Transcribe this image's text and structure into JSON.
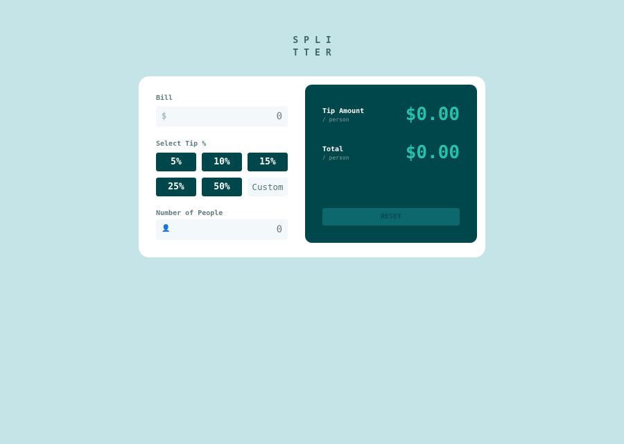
{
  "logo": {
    "line1": "SPLI",
    "line2": "TTER"
  },
  "bill": {
    "label": "Bill",
    "icon": "dollar-icon",
    "icon_glyph": "$",
    "value": "",
    "placeholder": "0"
  },
  "tip": {
    "label": "Select Tip %",
    "options": [
      "5%",
      "10%",
      "15%",
      "25%",
      "50%"
    ],
    "custom_placeholder": "Custom"
  },
  "people": {
    "label": "Number of People",
    "icon": "person-icon",
    "icon_glyph": "👤",
    "value": "",
    "placeholder": "0"
  },
  "results": {
    "tip_amount": {
      "title": "Tip Amount",
      "sub": "/ person",
      "value": "$0.00"
    },
    "total": {
      "title": "Total",
      "sub": "/ person",
      "value": "$0.00"
    },
    "reset_label": "RESET"
  },
  "colors": {
    "background": "#c5e4e7",
    "card": "#ffffff",
    "primary": "#00474b",
    "accent": "#26c0ab",
    "input_bg": "#f3f9fa"
  }
}
